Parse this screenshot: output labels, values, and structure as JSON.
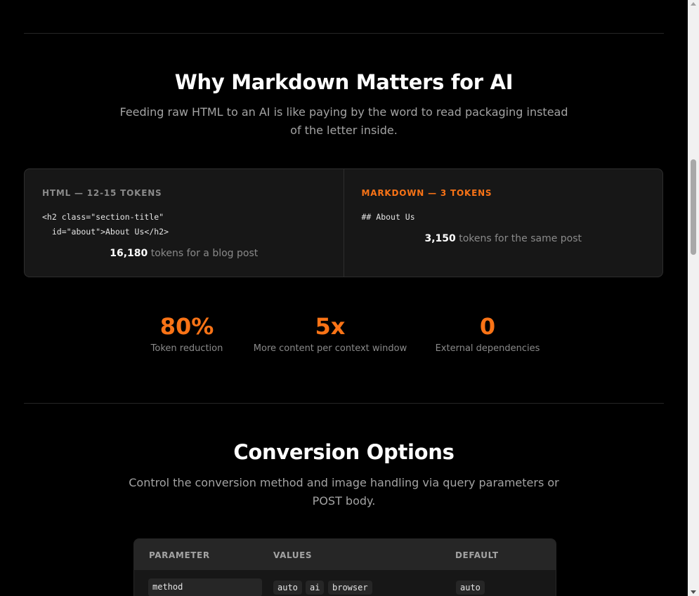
{
  "why": {
    "title": "Why Markdown Matters for AI",
    "subtitle_line1": "Feeding raw HTML to an AI is like paying by the word to read packaging instead",
    "subtitle_line2": "of the letter inside."
  },
  "comparison": {
    "html": {
      "label": "HTML — 12-15 TOKENS",
      "code": "<h2 class=\"section-title\"\n  id=\"about\">About Us</h2>",
      "count": "16,180",
      "count_suffix": " tokens for a blog post"
    },
    "markdown": {
      "label": "MARKDOWN — 3 TOKENS",
      "code": "## About Us",
      "count": "3,150",
      "count_suffix": " tokens for the same post"
    }
  },
  "stats": [
    {
      "value": "80%",
      "label": "Token reduction"
    },
    {
      "value": "5x",
      "label": "More content per context window"
    },
    {
      "value": "0",
      "label": "External dependencies"
    }
  ],
  "options": {
    "title": "Conversion Options",
    "subtitle_line1": "Control the conversion method and image handling via query parameters or",
    "subtitle_line2": "POST body.",
    "table": {
      "headers": [
        "PARAMETER",
        "VALUES",
        "DEFAULT"
      ],
      "rows": [
        {
          "parameter": "method",
          "values": [
            "auto",
            "ai",
            "browser"
          ],
          "default": "auto"
        }
      ]
    }
  },
  "colors": {
    "accent": "#f97316",
    "background": "#000000",
    "card": "#171717"
  }
}
